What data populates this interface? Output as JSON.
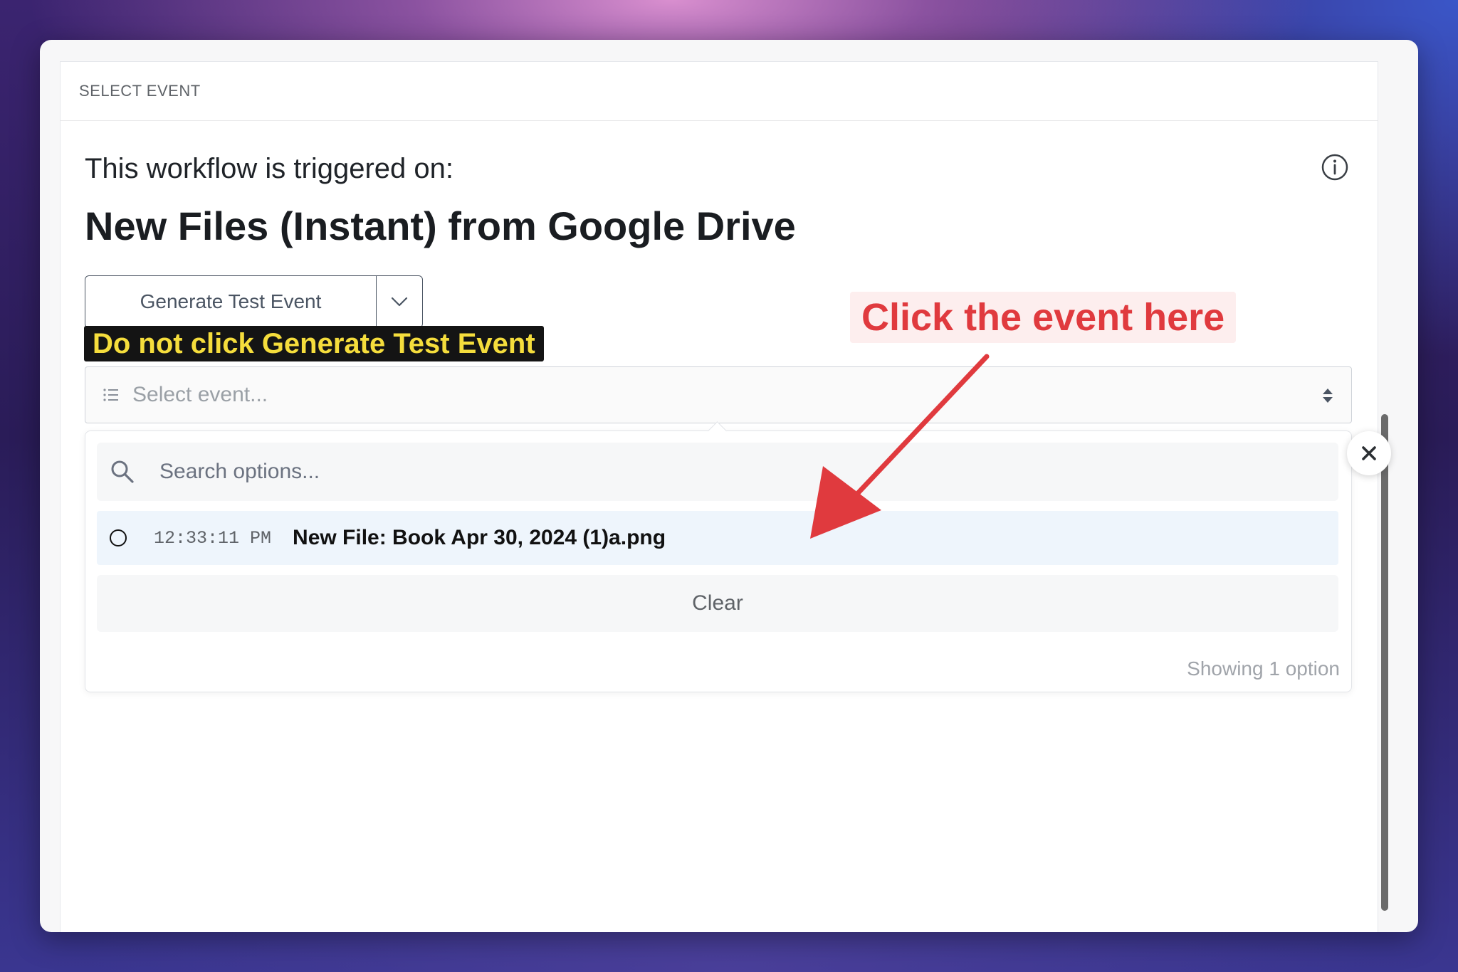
{
  "panel": {
    "header": "SELECT EVENT"
  },
  "trigger": {
    "intro": "This workflow is triggered on:",
    "title": "New Files (Instant) from Google Drive"
  },
  "generate": {
    "label": "Generate Test Event"
  },
  "annotations": {
    "warning": "Do not click Generate Test Event",
    "callout": "Click the event here",
    "warning_color": "#f5dd3c",
    "callout_color": "#e03a3e"
  },
  "select": {
    "placeholder": "Select event..."
  },
  "dropdown": {
    "search_placeholder": "Search options...",
    "options": [
      {
        "time": "12:33:11 PM",
        "name": "New File: Book Apr 30, 2024 (1)a.png"
      }
    ],
    "clear_label": "Clear",
    "footer": "Showing 1 option"
  }
}
